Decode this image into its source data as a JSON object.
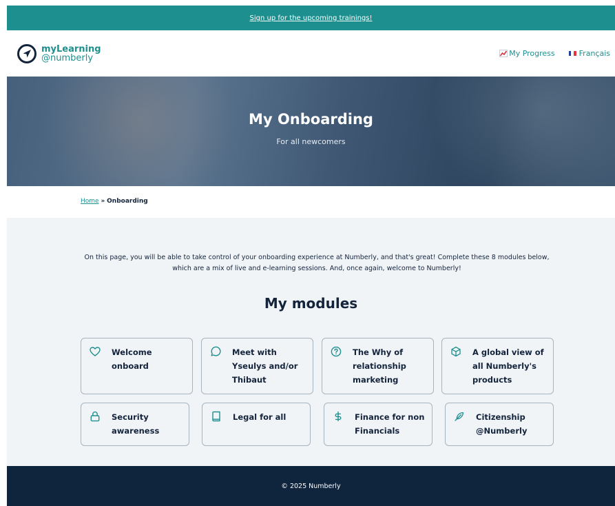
{
  "banner": {
    "link_text": "Sign up for the upcoming trainings!"
  },
  "header": {
    "logo_top": "myLearning",
    "logo_bottom": "@numberly",
    "nav": {
      "progress_label": "My Progress",
      "language_label": "Français"
    }
  },
  "hero": {
    "title": "My Onboarding",
    "subtitle": "For all newcomers"
  },
  "breadcrumb": {
    "home": "Home",
    "separator": "»",
    "current": "Onboarding"
  },
  "intro": "On this page, you will be able to take control of your onboarding experience at Numberly, and that's great! Complete these 8 modules below, which are a mix of live and e-learning sessions. And, once again, welcome to Numberly!",
  "modules": {
    "title": "My modules",
    "items": [
      {
        "label": "Welcome onboard",
        "icon": "heart-icon"
      },
      {
        "label": "Meet with Yseulys and/or Thibaut",
        "icon": "chat-bubble-icon"
      },
      {
        "label": "The Why of relationship marketing",
        "icon": "question-circle-icon"
      },
      {
        "label": "A global view of all Numberly's products",
        "icon": "cube-icon"
      },
      {
        "label": "Security awareness",
        "icon": "lock-icon"
      },
      {
        "label": "Legal for all",
        "icon": "book-icon"
      },
      {
        "label": "Finance for non Financials",
        "icon": "dollar-icon"
      },
      {
        "label": "Citizenship @Numberly",
        "icon": "feather-icon"
      }
    ]
  },
  "footer": {
    "copyright": "© 2025 Numberly"
  },
  "colors": {
    "accent": "#1e8f8f",
    "dark_navy": "#0f243d",
    "light_bg": "#f0f4f7",
    "text": "#13233b"
  }
}
